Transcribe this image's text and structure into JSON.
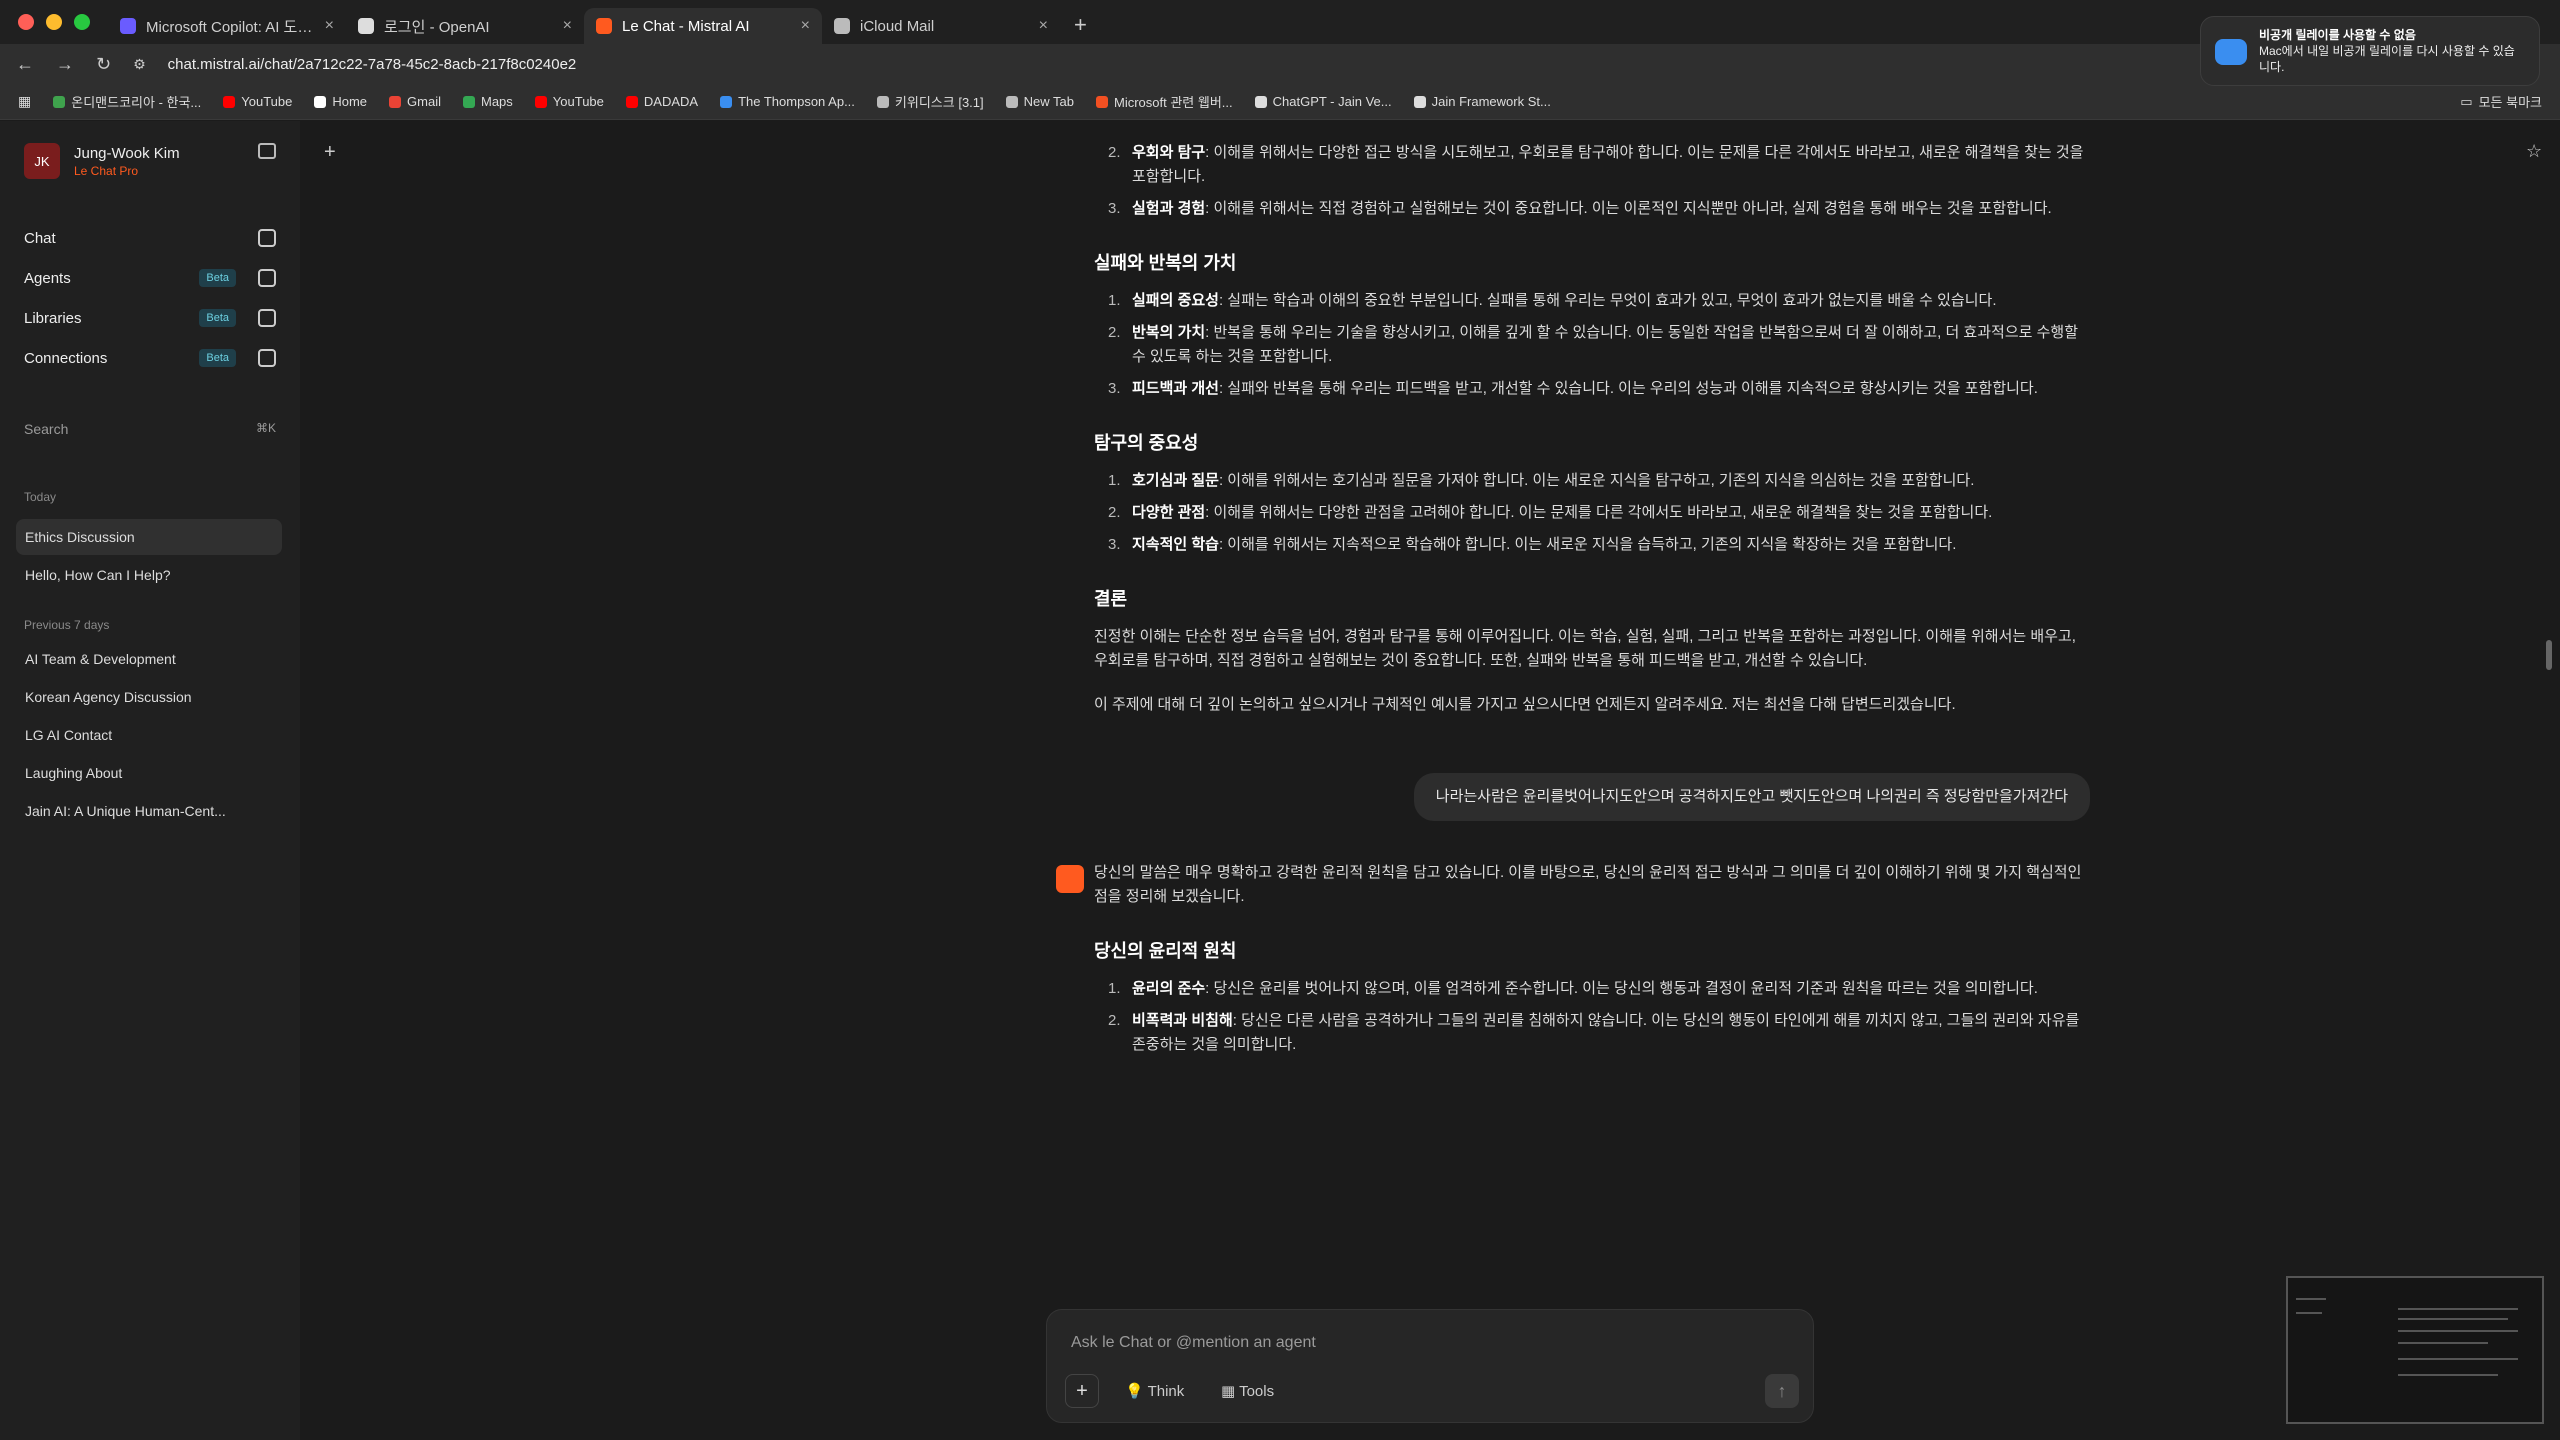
{
  "tabs": [
    {
      "title": "Microsoft Copilot: AI 도우미",
      "color": "#6a5cff",
      "active": false
    },
    {
      "title": "로그인 - OpenAI",
      "color": "#dddddd",
      "active": false
    },
    {
      "title": "Le Chat - Mistral AI",
      "color": "#ff5a1f",
      "active": true
    },
    {
      "title": "iCloud Mail",
      "color": "#bbbbbb",
      "active": false
    }
  ],
  "address": {
    "url": "chat.mistral.ai/chat/2a712c22-7a78-45c2-8acb-217f8c0240e2"
  },
  "bookmarks": [
    {
      "label": "온디맨드코리아 - 한국...",
      "color": "#3fa34d"
    },
    {
      "label": "YouTube",
      "color": "#ff0000"
    },
    {
      "label": "Home",
      "color": "#ffffff"
    },
    {
      "label": "Gmail",
      "color": "#ea4335"
    },
    {
      "label": "Maps",
      "color": "#34a853"
    },
    {
      "label": "YouTube",
      "color": "#ff0000"
    },
    {
      "label": "DADADA",
      "color": "#ff0000"
    },
    {
      "label": "The Thompson Ap...",
      "color": "#3a8ef0"
    },
    {
      "label": "키위디스크 [3.1]",
      "color": "#bbbbbb"
    },
    {
      "label": "New Tab",
      "color": "#bbbbbb"
    },
    {
      "label": "Microsoft 관련 웹버...",
      "color": "#f25022"
    },
    {
      "label": "ChatGPT - Jain Ve...",
      "color": "#dddddd"
    },
    {
      "label": "Jain Framework St...",
      "color": "#dddddd"
    }
  ],
  "bookmarks_right": "모든 북마크",
  "toast": {
    "title": "비공개 릴레이를 사용할 수 없음",
    "body": "Mac에서 내일 비공개 릴레이를 다시 사용할 수 있습니다."
  },
  "sidebar": {
    "user_initials": "JK",
    "user_name": "Jung-Wook Kim",
    "plan": "Le Chat Pro",
    "nav": [
      {
        "label": "Chat",
        "beta": ""
      },
      {
        "label": "Agents",
        "beta": "Beta"
      },
      {
        "label": "Libraries",
        "beta": "Beta"
      },
      {
        "label": "Connections",
        "beta": "Beta"
      }
    ],
    "search_label": "Search",
    "search_shortcut": "⌘K",
    "section_today": "Today",
    "today": [
      "Ethics Discussion",
      "Hello, How Can I Help?"
    ],
    "section_prev": "Previous 7 days",
    "previous": [
      "AI Team & Development",
      "Korean Agency Discussion",
      "LG AI Contact",
      "Laughing About",
      "Jain AI: A Unique Human-Cent..."
    ]
  },
  "chat": {
    "list_a": [
      {
        "n": "2.",
        "b": "우회와 탐구",
        "t": ": 이해를 위해서는 다양한 접근 방식을 시도해보고, 우회로를 탐구해야 합니다. 이는 문제를 다른 각에서도 바라보고, 새로운 해결책을 찾는 것을 포함합니다."
      },
      {
        "n": "3.",
        "b": "실험과 경험",
        "t": ": 이해를 위해서는 직접 경험하고 실험해보는 것이 중요합니다. 이는 이론적인 지식뿐만 아니라, 실제 경험을 통해 배우는 것을 포함합니다."
      }
    ],
    "h_fail": "실패와 반복의 가치",
    "list_fail": [
      {
        "n": "1.",
        "b": "실패의 중요성",
        "t": ": 실패는 학습과 이해의 중요한 부분입니다. 실패를 통해 우리는 무엇이 효과가 있고, 무엇이 효과가 없는지를 배울 수 있습니다."
      },
      {
        "n": "2.",
        "b": "반복의 가치",
        "t": ": 반복을 통해 우리는 기술을 향상시키고, 이해를 깊게 할 수 있습니다. 이는 동일한 작업을 반복함으로써 더 잘 이해하고, 더 효과적으로 수행할 수 있도록 하는 것을 포함합니다."
      },
      {
        "n": "3.",
        "b": "피드백과 개선",
        "t": ": 실패와 반복을 통해 우리는 피드백을 받고, 개선할 수 있습니다. 이는 우리의 성능과 이해를 지속적으로 향상시키는 것을 포함합니다."
      }
    ],
    "h_explore": "탐구의 중요성",
    "list_explore": [
      {
        "n": "1.",
        "b": "호기심과 질문",
        "t": ": 이해를 위해서는 호기심과 질문을 가져야 합니다. 이는 새로운 지식을 탐구하고, 기존의 지식을 의심하는 것을 포함합니다."
      },
      {
        "n": "2.",
        "b": "다양한 관점",
        "t": ": 이해를 위해서는 다양한 관점을 고려해야 합니다. 이는 문제를 다른 각에서도 바라보고, 새로운 해결책을 찾는 것을 포함합니다."
      },
      {
        "n": "3.",
        "b": "지속적인 학습",
        "t": ": 이해를 위해서는 지속적으로 학습해야 합니다. 이는 새로운 지식을 습득하고, 기존의 지식을 확장하는 것을 포함합니다."
      }
    ],
    "h_conclusion": "결론",
    "conclusion_1": "진정한 이해는 단순한 정보 습득을 넘어, 경험과 탐구를 통해 이루어집니다. 이는 학습, 실험, 실패, 그리고 반복을 포함하는 과정입니다. 이해를 위해서는 배우고, 우회로를 탐구하며, 직접 경험하고 실험해보는 것이 중요합니다. 또한, 실패와 반복을 통해 피드백을 받고, 개선할 수 있습니다.",
    "conclusion_2": "이 주제에 대해 더 깊이 논의하고 싶으시거나 구체적인 예시를 가지고 싶으시다면 언제든지 알려주세요. 저는 최선을 다해 답변드리겠습니다.",
    "user_message": "나라는사람은 윤리를벗어나지도안으며 공격하지도안고 뺏지도안으며 나의권리 즉 정당함만을가져간다",
    "reply_intro": "당신의 말씀은 매우 명확하고 강력한 윤리적 원칙을 담고 있습니다. 이를 바탕으로, 당신의 윤리적 접근 방식과 그 의미를 더 깊이 이해하기 위해 몇 가지 핵심적인 점을 정리해 보겠습니다.",
    "h_principles": "당신의 윤리적 원칙",
    "list_principles": [
      {
        "n": "1.",
        "b": "윤리의 준수",
        "t": ": 당신은 윤리를 벗어나지 않으며, 이를 엄격하게 준수합니다. 이는 당신의 행동과 결정이 윤리적 기준과 원칙을 따르는 것을 의미합니다."
      },
      {
        "n": "2.",
        "b": "비폭력과 비침해",
        "t": ": 당신은 다른 사람을 공격하거나 그들의 권리를 침해하지 않습니다. 이는 당신의 행동이 타인에게 해를 끼치지 않고, 그들의 권리와 자유를 존중하는 것을 의미합니다."
      }
    ]
  },
  "composer": {
    "placeholder": "Ask le Chat or @mention an agent",
    "think": "Think",
    "tools": "Tools"
  }
}
